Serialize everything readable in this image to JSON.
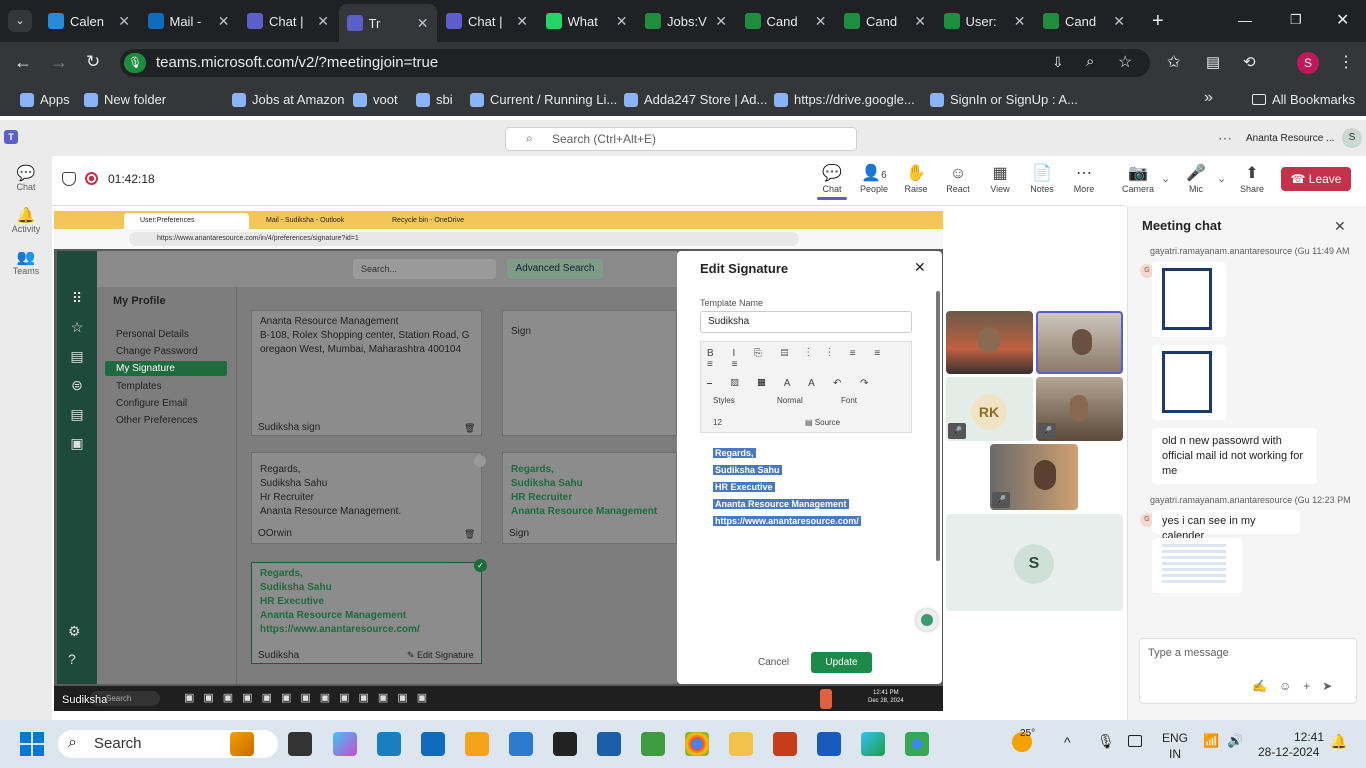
{
  "browser": {
    "tabs": [
      {
        "label": "Calen",
        "color": "#2b88d8"
      },
      {
        "label": "Mail -",
        "color": "#0f6cbd"
      },
      {
        "label": "Chat |",
        "color": "#5b5fc7"
      },
      {
        "label": "Tr",
        "color": "#5b5fc7"
      },
      {
        "label": "Chat |",
        "color": "#5b5fc7"
      },
      {
        "label": "What",
        "color": "#25d366"
      },
      {
        "label": "Jobs:V",
        "color": "#1e8e3e"
      },
      {
        "label": "Cand",
        "color": "#1e8e3e"
      },
      {
        "label": "Cand",
        "color": "#1e8e3e"
      },
      {
        "label": "User:",
        "color": "#1e8e3e"
      },
      {
        "label": "Cand",
        "color": "#1e8e3e"
      }
    ],
    "new_tab": "+",
    "url": "teams.microsoft.com/v2/?meetingjoin=true",
    "profile_initial": "S",
    "bookmarks": [
      {
        "label": "Apps",
        "icon": "apps-icon"
      },
      {
        "label": "New folder",
        "icon": "folder-icon"
      },
      {
        "label": "Jobs at Amazon",
        "icon": "amazon-icon"
      },
      {
        "label": "voot",
        "icon": "voot-icon"
      },
      {
        "label": "sbi",
        "icon": "sbi-icon"
      },
      {
        "label": "Current / Running Li...",
        "icon": "ban-icon"
      },
      {
        "label": "Adda247 Store | Ad...",
        "icon": "adda-icon"
      },
      {
        "label": "https://drive.google...",
        "icon": "drive-icon"
      },
      {
        "label": "SignIn or SignUp : A...",
        "icon": "ban-icon"
      }
    ],
    "more_bookmarks": "»",
    "all_bookmarks": "All Bookmarks"
  },
  "teams": {
    "search_placeholder": "Search (Ctrl+Alt+E)",
    "org": "Ananta Resource ...",
    "user_initial": "S",
    "rail": [
      {
        "label": "Chat"
      },
      {
        "label": "Activity"
      },
      {
        "label": "Teams"
      }
    ],
    "timer": "01:42:18",
    "toolbar": [
      {
        "label": "Chat",
        "glyph": "💬"
      },
      {
        "label": "People",
        "glyph": "👤",
        "count": "6"
      },
      {
        "label": "Raise",
        "glyph": "✋"
      },
      {
        "label": "React",
        "glyph": "☺"
      },
      {
        "label": "View",
        "glyph": "▦"
      },
      {
        "label": "Notes",
        "glyph": "📄"
      },
      {
        "label": "More",
        "glyph": "⋯"
      },
      {
        "label": "Camera",
        "glyph": "📷"
      },
      {
        "label": "Mic",
        "glyph": "🎤"
      },
      {
        "label": "Share",
        "glyph": "⬆"
      }
    ],
    "leave": "Leave"
  },
  "shared": {
    "tabs": [
      "User:Preferences",
      "Mail - Sudiksha - Outlook",
      "Recycle bin - OneDrive"
    ],
    "url": "https://www.anantaresource.com/in/4/preferences/signature?id=1",
    "crm": {
      "search_placeholder": "Search...",
      "advanced_search": "Advanced Search",
      "my_profile": "My Profile",
      "menu": [
        "Personal Details",
        "Change Password",
        "My Signature",
        "Templates",
        "Configure Email",
        "Other Preferences"
      ],
      "card1_lines": [
        "Ananta Resource Management",
        "B-108, Rolex Shopping center, Station Road, G",
        "oregaon West, Mumbai, Maharashtra 400104"
      ],
      "card1_name": "Sudiksha sign",
      "card_right_top": "Sign",
      "card2_lines": [
        "Regards,",
        "Sudiksha Sahu",
        "Hr Recruiter",
        "Ananta Resource Management."
      ],
      "card2_name": "OOrwin",
      "card3_lines": [
        "Regards,",
        "Sudiksha Sahu",
        "HR Recruiter",
        "Ananta Resource Management"
      ],
      "card3_name": "Sign",
      "card4_lines": [
        "Regards,",
        "Sudiksha Sahu",
        "HR Executive",
        "Ananta Resource Management",
        "https://www.anantaresource.com/"
      ],
      "card4_name": "Sudiksha",
      "edit_signature_link": "Edit Signature"
    },
    "modal": {
      "title": "Edit Signature",
      "template_label": "Template Name",
      "template_value": "Sudiksha",
      "styles": "Styles",
      "format": "Normal",
      "font": "Font",
      "size": "12",
      "source": "Source",
      "body": [
        "Regards,",
        "Sudiksha Sahu",
        "HR Executive",
        "Ananta Resource Management",
        "https://www.anantaresource.com/"
      ],
      "cancel": "Cancel",
      "update": "Update"
    },
    "taskbar_search": "Search",
    "taskbar_time": "12:41 PM",
    "taskbar_date": "Dec 28, 2024",
    "presenter": "Sudiksha"
  },
  "videos": [
    {
      "initials": "RK"
    },
    {
      "initials": "S"
    }
  ],
  "chat": {
    "title": "Meeting chat",
    "msgs": [
      {
        "sender": "gayatri.ramayanam.anantaresource (Gu",
        "time": "11:49 AM",
        "avatar": "G"
      },
      {
        "text": "old n new passowrd with official mail id not working for me"
      },
      {
        "sender": "gayatri.ramayanam.anantaresource (Gu",
        "time": "12:23 PM",
        "avatar": "G"
      },
      {
        "text": "yes i can see in my calender"
      }
    ],
    "placeholder": "Type a message"
  },
  "windows": {
    "weather": "25°",
    "search": "Search",
    "lang1": "ENG",
    "lang2": "IN",
    "time": "12:41",
    "date": "28-12-2024"
  }
}
